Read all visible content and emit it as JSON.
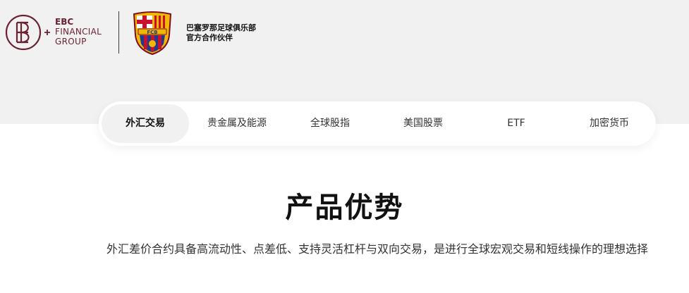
{
  "brand": {
    "ebc_line1": "EBC",
    "ebc_line2": "FINANCIAL",
    "ebc_line3": "GROUP",
    "brand_color": "#6b2233",
    "partner_line1": "巴塞罗那足球俱乐部",
    "partner_line2": "官方合作伙伴",
    "crest_label": "FCB"
  },
  "tabs": [
    {
      "label": "外汇交易",
      "active": true
    },
    {
      "label": "贵金属及能源",
      "active": false
    },
    {
      "label": "全球股指",
      "active": false
    },
    {
      "label": "美国股票",
      "active": false
    },
    {
      "label": "ETF",
      "active": false
    },
    {
      "label": "加密货币",
      "active": false
    }
  ],
  "section": {
    "title": "产品优势",
    "description": "外汇差价合约具备高流动性、点差低、支持灵活杠杆与双向交易，是进行全球宏观交易和短线操作的理想选择"
  },
  "colors": {
    "band_bg": "#f1f1f1",
    "active_tab_bg": "#f1f1f1",
    "crest_red": "#c8102e",
    "crest_blue": "#1d3c8f",
    "crest_gold": "#f2b705"
  }
}
